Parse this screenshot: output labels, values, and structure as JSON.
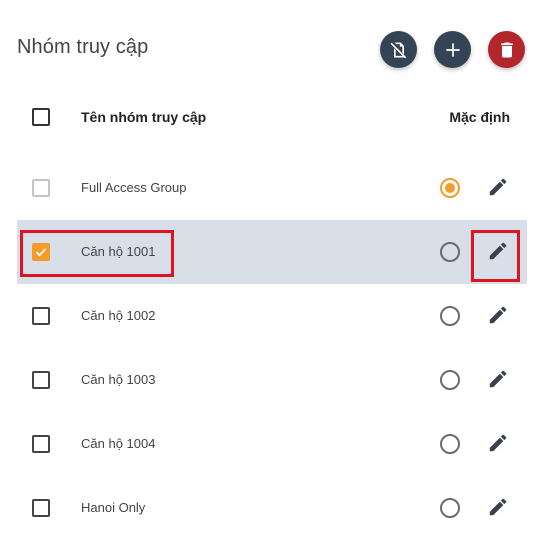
{
  "page": {
    "title": "Nhóm truy cập"
  },
  "toolbar": {
    "actions": [
      {
        "name": "disable-card-button",
        "icon": "no-card-icon",
        "color": "#354455"
      },
      {
        "name": "add-button",
        "icon": "plus-icon",
        "color": "#354455"
      },
      {
        "name": "delete-button",
        "icon": "trash-icon",
        "color": "#b3262b"
      }
    ]
  },
  "table": {
    "headers": {
      "name": "Tên nhóm truy cập",
      "default": "Mặc định"
    },
    "rows": [
      {
        "name": "Full Access Group",
        "checked": false,
        "checkbox_disabled": true,
        "default": true,
        "selected": false
      },
      {
        "name": "Căn hộ 1001",
        "checked": true,
        "checkbox_disabled": false,
        "default": false,
        "selected": true
      },
      {
        "name": "Căn hộ 1002",
        "checked": false,
        "checkbox_disabled": false,
        "default": false,
        "selected": false
      },
      {
        "name": "Căn hộ 1003",
        "checked": false,
        "checkbox_disabled": false,
        "default": false,
        "selected": false
      },
      {
        "name": "Căn hộ 1004",
        "checked": false,
        "checkbox_disabled": false,
        "default": false,
        "selected": false
      },
      {
        "name": "Hanoi Only",
        "checked": false,
        "checkbox_disabled": false,
        "default": false,
        "selected": false
      }
    ]
  },
  "colors": {
    "accent": "#f39c2a",
    "selected_row": "#d8dfe8",
    "highlight": "#e0141e"
  }
}
